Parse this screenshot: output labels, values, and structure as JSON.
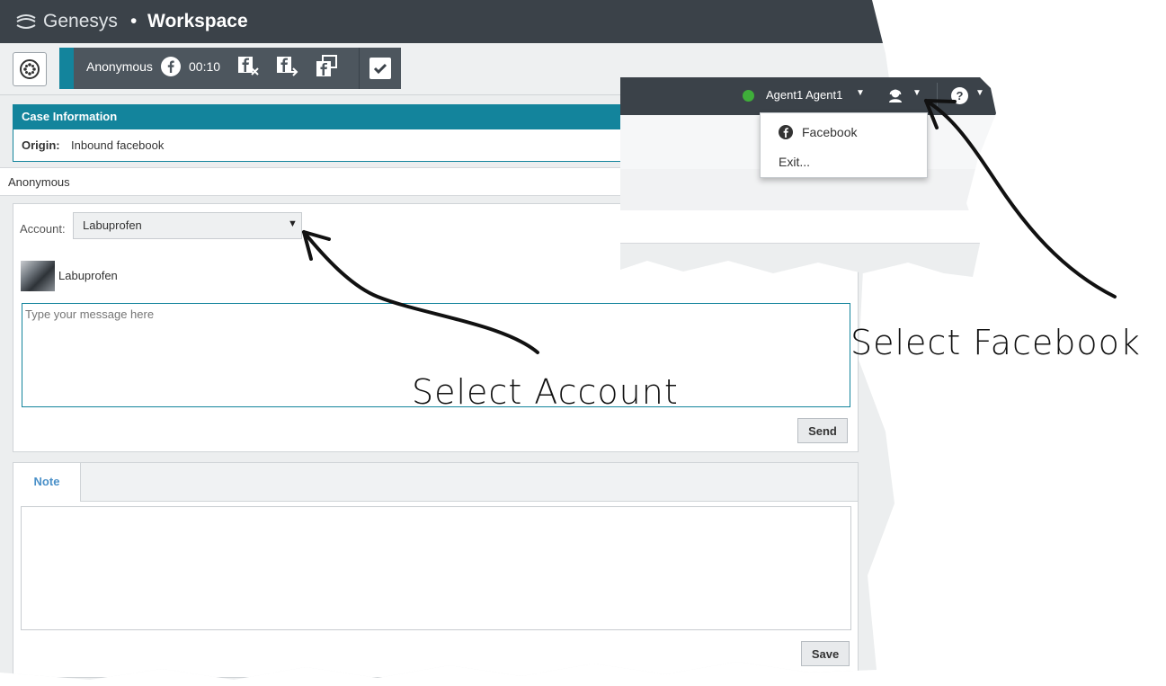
{
  "brand": {
    "name": "Genesys",
    "separator": "•",
    "product": "Workspace"
  },
  "interaction": {
    "contact": "Anonymous",
    "channel_icon": "facebook-icon",
    "timer": "00:10",
    "toolbar_icons": [
      "facebook-end-icon",
      "facebook-transfer-icon",
      "facebook-consult-icon",
      "mark-done-icon"
    ]
  },
  "case_info": {
    "title": "Case Information",
    "origin_label": "Origin:",
    "origin_value": "Inbound facebook"
  },
  "contact_strip": {
    "name": "Anonymous"
  },
  "compose": {
    "account_label": "Account:",
    "account_value": "Labuprofen",
    "account_caret": "▼",
    "avatar_name": "Labuprofen",
    "message_placeholder": "Type your message here",
    "send_label": "Send"
  },
  "notes": {
    "tab_label": "Note",
    "save_label": "Save"
  },
  "agent": {
    "name": "Agent1 Agent1",
    "status_color": "#3fae3a",
    "caret": "▼",
    "channel_icon": "agent-channels-icon",
    "help_label": "?"
  },
  "agent_menu": {
    "items": [
      {
        "label": "Facebook",
        "icon": "facebook-icon"
      },
      {
        "label": "Exit..."
      }
    ]
  },
  "annotations": {
    "select_account": "Select Account",
    "select_facebook": "Select Facebook"
  },
  "colors": {
    "accent": "#13849c",
    "topbar": "#3b4249",
    "interaction_bar": "#4d565e"
  }
}
